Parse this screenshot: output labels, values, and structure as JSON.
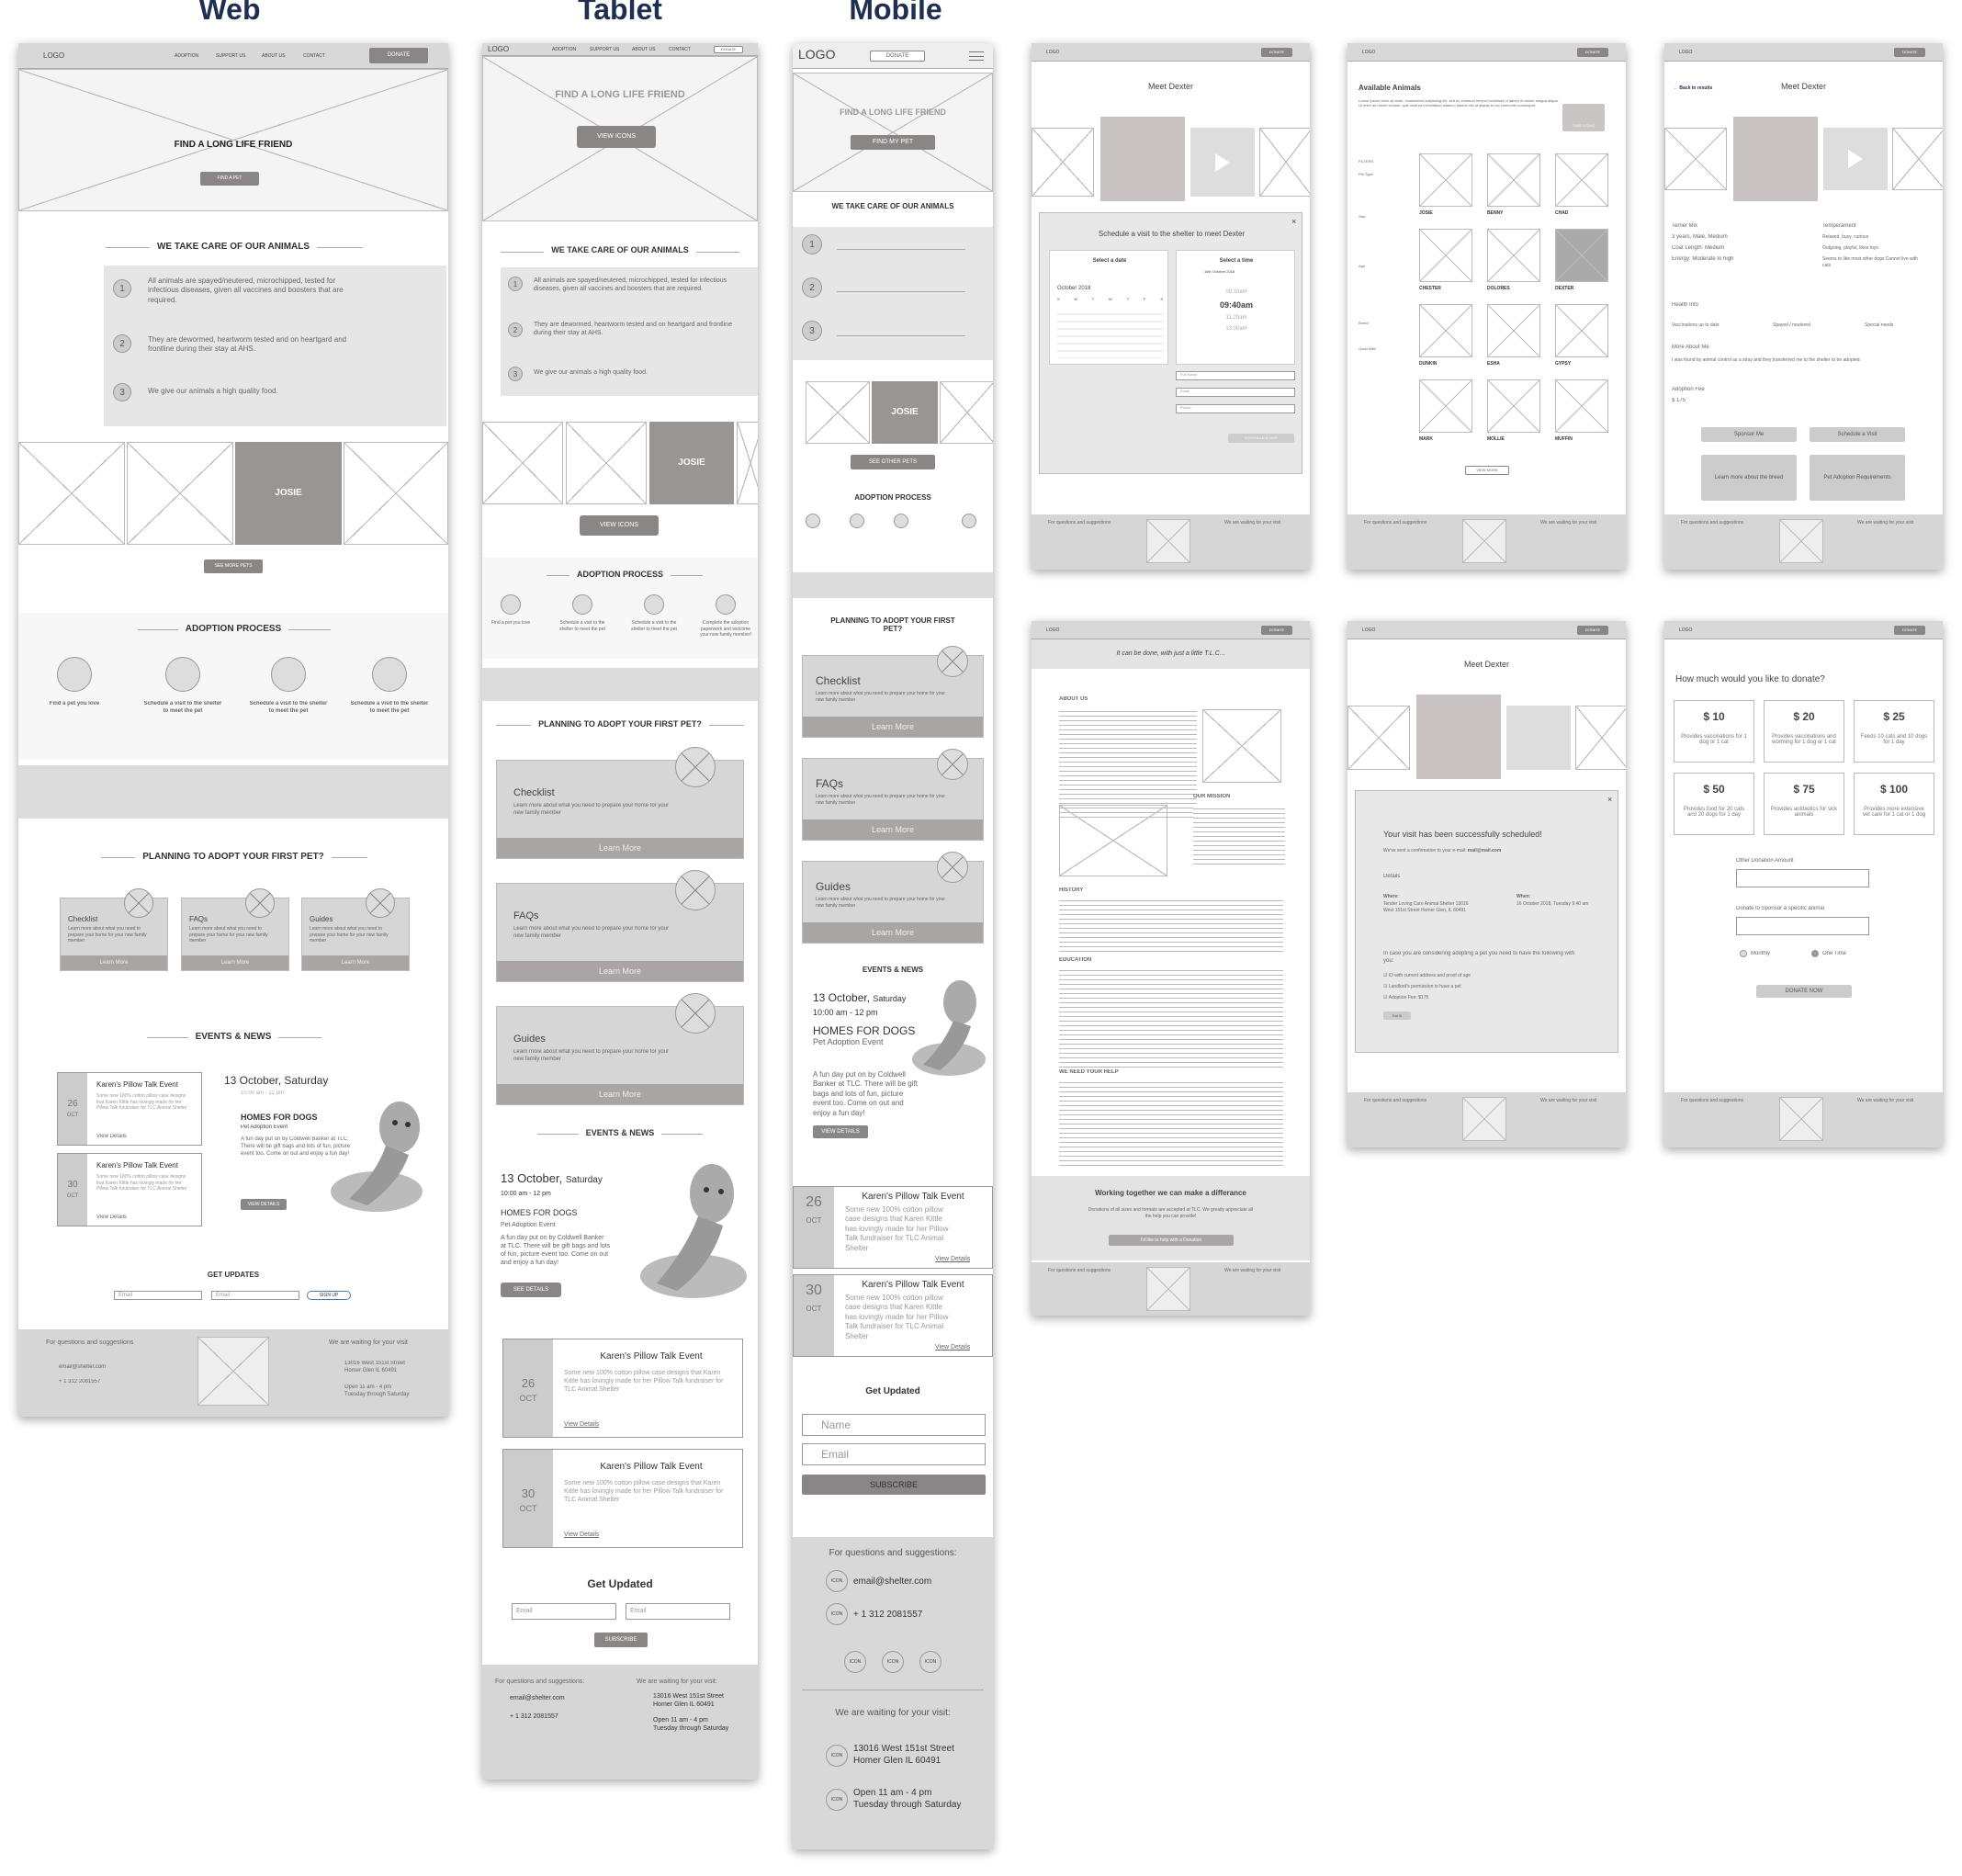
{
  "columns": {
    "web": "Web",
    "tablet": "Tablet",
    "mobile": "Mobile"
  },
  "nav": {
    "logo": "LOGO",
    "adoption": "ADOPTION",
    "support": "SUPPORT US",
    "about": "ABOUT US",
    "contact": "CONTACT",
    "donate": "DONATE"
  },
  "hero": {
    "title": "FIND A LONG LIFE FRIEND",
    "web_button": "FIND A PET",
    "tablet_button": "VIEW ICONS",
    "mobile_button": "FIND MY PET"
  },
  "care": {
    "title": "WE TAKE CARE OF OUR ANIMALS",
    "items": [
      {
        "num": "1",
        "text": "All animals are spayed/neutered, microchipped, tested for infectious diseases, given all vaccines and boosters that are required."
      },
      {
        "num": "2",
        "text": "They are dewormed, heartworm tested and on heartgard and frontline during their stay at AHS."
      },
      {
        "num": "3",
        "text": "We give our animals a high quality food."
      }
    ]
  },
  "pets": {
    "featured": "JOSIE",
    "web_button": "SEE MORE PETS",
    "tablet_button": "VIEW ICONS",
    "mobile_button": "SEE OTHER PETS"
  },
  "process": {
    "title": "ADOPTION PROCESS",
    "steps": [
      "Find a pet you love",
      "Schedule a visit to the shelter to meet the pet",
      "Schedule a visit to the shelter to meet the pet",
      "Schedule a visit to the shelter to meet the pet"
    ],
    "tablet_last": "Complete the adoption paperwork and welcome your new family member!"
  },
  "planning": {
    "title": "PLANNING TO ADOPT YOUR FIRST PET?",
    "cards": [
      {
        "title": "Checklist",
        "body": "Learn more about what you need to prepare your home for your new family member",
        "cta": "Learn More"
      },
      {
        "title": "FAQs",
        "body": "Learn more about what you need to prepare your home for your new family member",
        "cta": "Learn More"
      },
      {
        "title": "Guides",
        "body": "Learn more about what you need to prepare your home for your new family member",
        "cta": "Learn More"
      }
    ]
  },
  "events": {
    "title": "EVENTS & NEWS",
    "feature_date": "13 October,",
    "feature_day": "Saturday",
    "feature_time": "10:00 am - 12 pm",
    "feature_title": "HOMES FOR DOGS",
    "feature_sub": "Pet Adoption Event",
    "feature_body": "A fun day put on by Coldwell Banker at TLC. There will be gift bags and lots of fun, picture event too. Come on out and enjoy a fun day!",
    "feature_button": "VIEW DETAILS",
    "tablet_feature_button": "SEE DETAILS",
    "list": [
      {
        "day": "26",
        "month": "OCT",
        "title": "Karen's Pillow Talk Event",
        "body": "Some new 100% cotton pillow case designs that Karen Kittle has lovingly made for her Pillow Talk fundraiser for TLC Animal Shelter",
        "link": "View Details"
      },
      {
        "day": "30",
        "month": "OCT",
        "title": "Karen's Pillow Talk Event",
        "body": "Some new 100% cotton pillow case designs that Karen Kittle has lovingly made for her Pillow Talk fundraiser for TLC Animal Shelter",
        "link": "View Details"
      }
    ]
  },
  "updates": {
    "web_title": "GET UPDATES",
    "tablet_title": "Get Updated",
    "mobile_title": "Get Updated",
    "email": "Email",
    "name": "Name",
    "web_button": "SIGN UP",
    "button": "SUBSCRIBE"
  },
  "footer": {
    "questions": "For questions and suggestions",
    "questions_colon": "For questions and suggestions:",
    "email": "email@shelter.com",
    "phone": "+ 1 312 2081557",
    "waiting": "We are waiting for your visit",
    "waiting_colon": "We are waiting for your visit:",
    "street": "13016 West 151st Street",
    "city": "Homer Glen IL 60491",
    "hours": "Open 11 am - 4 pm",
    "days": "Tuesday through Saturday",
    "icon": "ICON"
  },
  "meet": {
    "title": "Meet Dexter",
    "modal_title": "Schedule a visit to the shelter to meet Dexter",
    "select_date": "Select a date",
    "select_time": "Select a time",
    "month": "October 2018",
    "weekdays": [
      "S",
      "M",
      "T",
      "W",
      "T",
      "F",
      "S"
    ],
    "times": [
      "09:10am",
      "09:40am",
      "11:20am",
      "13:00am"
    ],
    "date_chip": "16th October 2018",
    "fields": [
      "Full Name",
      "Email",
      "Phone"
    ],
    "submit": "SCHEDULE A VISIT"
  },
  "available": {
    "title": "Available Animals",
    "intro": "Lorem ipsum dolor sit amet, consectetur adipiscing elit, sed do eiusmod tempor incididunt ut labore et dolore magna aliqua. Ut enim ad minim veniam, quis nostrud exercitation ullamco laboris nisi ut aliquip ex ea commodo consequat.",
    "quiz": "TAKE A QUIZ",
    "filters": "FILTERS",
    "filter_groups": [
      "Pet Type",
      "Size",
      "Age",
      "Breed",
      "Good With"
    ],
    "pets": [
      "JOSIE",
      "BENNY",
      "CHAD",
      "CHESTER",
      "DOLORES",
      "DEXTER",
      "DUNKIN",
      "ESHA",
      "GYPSY",
      "MARK",
      "MOLLIE",
      "MUFFIN"
    ],
    "more": "VIEW MORE"
  },
  "detail": {
    "back": "Back to results",
    "title": "Meet Dexter",
    "breed": "Terrier Mix",
    "age": "3 years, Male, Medium",
    "coat": "Coat Length:  Medium",
    "energy": "Energy:  Moderate to high",
    "temperament": "Temperament",
    "temp_items": [
      "Relaxed, busy, curious",
      "Outgoing, playful, likes toys",
      "Seems to like most other dogs Cannot live with cats"
    ],
    "health": "Health Info",
    "health_items": [
      "Vaccinations up to date",
      "Spayed / neutered",
      "Special needs"
    ],
    "more_about": "More About Me",
    "more_body": "I was found by animal control as a stray and they transferred me to the shelter to be adopted.",
    "fee_label": "Adoption Fee",
    "fee": "$ 175",
    "sponsor": "Sponsor Me",
    "visit": "Schedule a Visit",
    "learn": "Learn more about the breed",
    "req": "Pet Adoption Requirements"
  },
  "about": {
    "tagline": "It can be done, with just a little T.L.C...",
    "about_title": "ABOUT US",
    "mission_title": "OUR MISSION",
    "history_title": "HISTORY",
    "education_title": "EDUCATION",
    "help_title": "WE NEED YOUR HELP",
    "cta_title": "Working together we can make a differance",
    "cta_body": "Donations of all sizes and formats are accepted at TLC. We greatly appreciate all the help you can provide!",
    "cta_button": "I'd like to help with a Donation"
  },
  "confirm": {
    "title": "Meet Dexter",
    "heading": "Your visit has been successfully scheduled!",
    "sent": "We've sent a confirmation to your e-mail:",
    "mail": "mail@mail.com",
    "details": "Details",
    "where": "Where:",
    "where_val": "Tender Loving Care Animal Shelter 13016 West 151st Street Homer Glen, IL 60491",
    "when": "When:",
    "when_val": "16 October 2018, Tuesday 9:40 am",
    "bring": "In case you are considering adopting a pet you need to have the following with you:",
    "checks": [
      "ID with current address and proof of age",
      "Landlord's permission to have a pet",
      "Adoption Fee: $175"
    ],
    "ok": "Got it!"
  },
  "donate": {
    "title": "How much would you like to donate?",
    "amounts": [
      {
        "amount": "$ 10",
        "desc": "Provides vaccinations for 1 dog or 1 cat"
      },
      {
        "amount": "$ 20",
        "desc": "Provides vaccinations and worming for 1 dog or 1 cat"
      },
      {
        "amount": "$ 25",
        "desc": "Feeds 10 cats and 10 dogs for 1 day"
      },
      {
        "amount": "$ 50",
        "desc": "Provides food for 20 cats and 20 dogs for 1 day"
      },
      {
        "amount": "$ 75",
        "desc": "Provides antibiotics for sick animals"
      },
      {
        "amount": "$ 100",
        "desc": "Provides more extensive vet care for 1 cat or 1 dog"
      }
    ],
    "other": "Other Donation Amount",
    "sponsor": "Donate to Sponsor a specific animal",
    "monthly": "Monthly",
    "once": "One Time",
    "button": "DONATE NOW"
  }
}
